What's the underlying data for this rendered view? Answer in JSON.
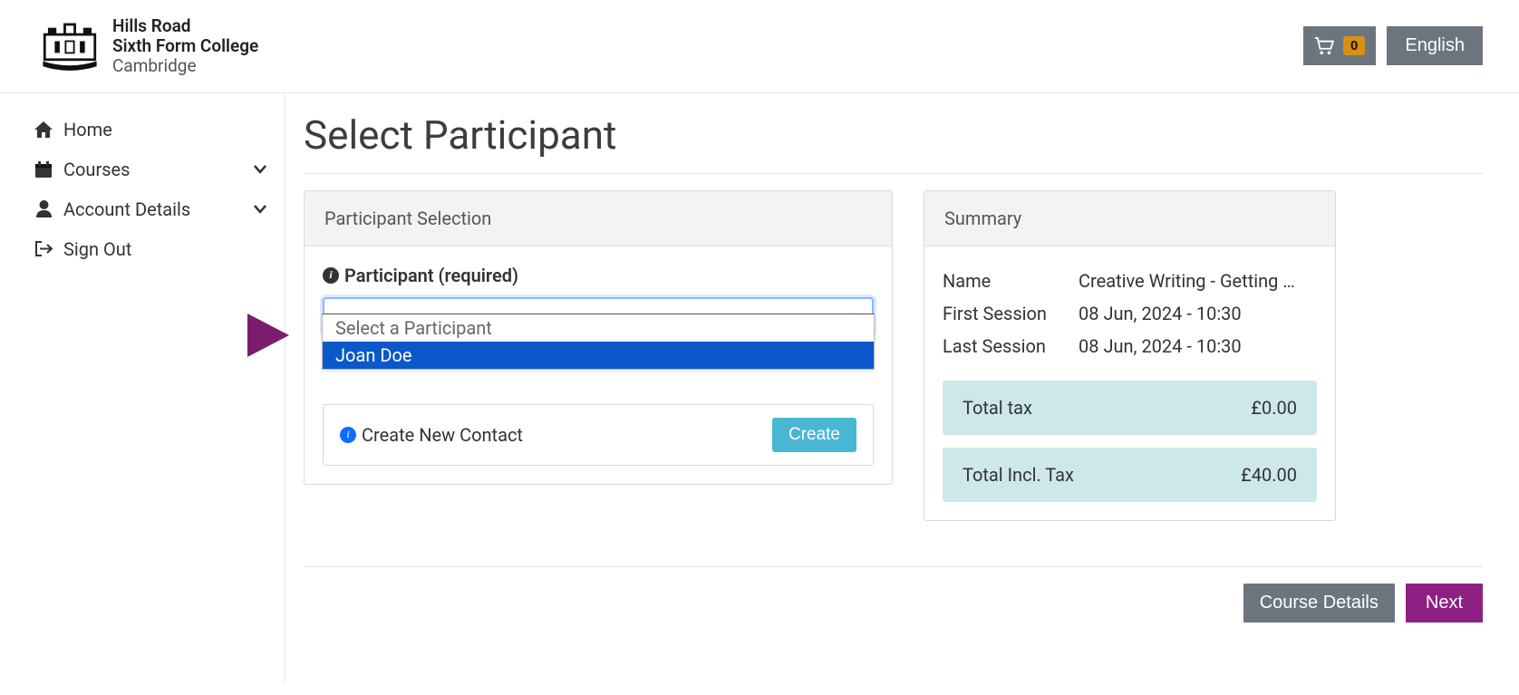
{
  "header": {
    "logo": {
      "line1": "Hills Road",
      "line2": "Sixth Form College",
      "line3": "Cambridge"
    },
    "cart_count": "0",
    "language": "English"
  },
  "sidebar": {
    "items": [
      {
        "icon": "home-icon",
        "label": "Home",
        "expandable": false
      },
      {
        "icon": "calendar-icon",
        "label": "Courses",
        "expandable": true
      },
      {
        "icon": "user-icon",
        "label": "Account Details",
        "expandable": true
      },
      {
        "icon": "signout-icon",
        "label": "Sign Out",
        "expandable": false
      }
    ]
  },
  "page": {
    "title": "Select Participant"
  },
  "participant_panel": {
    "header": "Participant Selection",
    "field_label": "Participant (required)",
    "dropdown": {
      "placeholder": "Select a Participant",
      "options": [
        "Joan Doe"
      ],
      "highlighted": "Joan Doe"
    },
    "create_label": "Create New Contact",
    "create_btn": "Create"
  },
  "summary_panel": {
    "header": "Summary",
    "rows": [
      {
        "label": "Name",
        "value": "Creative Writing - Getting …"
      },
      {
        "label": "First Session",
        "value": "08 Jun, 2024 - 10:30"
      },
      {
        "label": "Last Session",
        "value": "08 Jun, 2024 - 10:30"
      }
    ],
    "totals": [
      {
        "label": "Total tax",
        "value": "£0.00"
      },
      {
        "label": "Total Incl. Tax",
        "value": "£40.00"
      }
    ]
  },
  "footer": {
    "course_details": "Course Details",
    "next": "Next"
  }
}
